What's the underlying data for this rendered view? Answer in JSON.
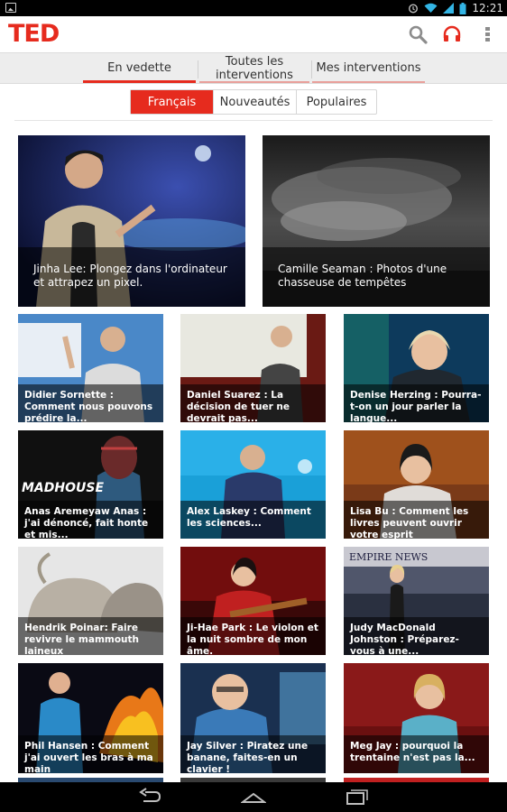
{
  "status_bar": {
    "time": "12:21"
  },
  "action_bar": {
    "logo": "TED",
    "icons": [
      "search-icon",
      "headphones-icon",
      "overflow-menu-icon"
    ]
  },
  "tabs": [
    {
      "label": "En vedette",
      "active": true
    },
    {
      "label": "Toutes les interventions",
      "active": false
    },
    {
      "label": "Mes interventions",
      "active": false
    }
  ],
  "filters": [
    {
      "label": "Français",
      "active": true
    },
    {
      "label": "Nouveautés",
      "active": false
    },
    {
      "label": "Populaires",
      "active": false
    }
  ],
  "featured": [
    {
      "title": "Jinha Lee: Plongez dans l'ordinateur et attrapez un pixel."
    },
    {
      "title": "Camille Seaman : Photos d'une chasseuse de tempêtes"
    }
  ],
  "talks": [
    {
      "title": "Didier Sornette : Comment nous pouvons prédire la..."
    },
    {
      "title": "Daniel Suarez : La décision de tuer ne devrait pas..."
    },
    {
      "title": "Denise Herzing : Pourra-t-on un jour parler la langue..."
    },
    {
      "title": "Anas Aremeyaw Anas : j'ai dénoncé, fait honte et mis..."
    },
    {
      "title": "Alex Laskey : Comment les sciences..."
    },
    {
      "title": "Lisa Bu : Comment les livres peuvent ouvrir votre esprit"
    },
    {
      "title": "Hendrik Poinar: Faire revivre le mammouth laineux"
    },
    {
      "title": "Ji-Hae Park : Le violon et la nuit sombre de mon âme."
    },
    {
      "title": "Judy MacDonald Johnston : Préparez-vous à une..."
    },
    {
      "title": "Phil Hansen : Comment j'ai ouvert les bras à ma main"
    },
    {
      "title": "Jay Silver : Piratez une banane, faites-en un clavier !"
    },
    {
      "title": "Meg Jay : pourquoi la trentaine n'est pas la..."
    }
  ],
  "image_texts": {
    "madhouse": "MADHOUSE",
    "empire_news": "EMPIRE NEWS"
  },
  "colors": {
    "accent": "#e62b1e",
    "tab_bar": "#ededed",
    "caption_bg": "rgba(0,0,0,0.55)"
  }
}
